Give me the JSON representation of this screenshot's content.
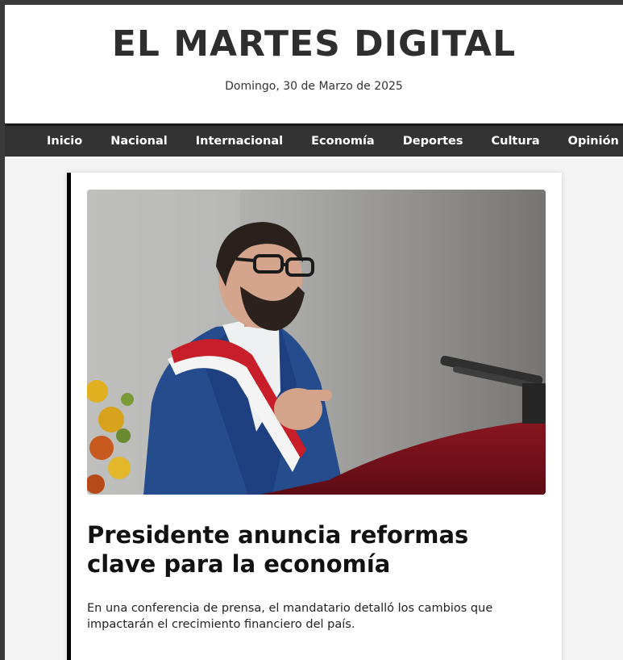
{
  "header": {
    "title": "EL MARTES DIGITAL",
    "date": "Domingo, 30 de Marzo de 2025"
  },
  "nav": {
    "items": [
      "Inicio",
      "Nacional",
      "Internacional",
      "Economía",
      "Deportes",
      "Cultura",
      "Opinión"
    ]
  },
  "article": {
    "image_icon": "photo-president-speaking",
    "title": "Presidente anuncia reformas clave para la economía",
    "summary": "En una conferencia de prensa, el mandatario detalló los cambios que impactarán el crecimiento financiero del país."
  },
  "colors": {
    "nav_bg": "#333333",
    "card_accent": "#000000",
    "page_bg": "#f3f3f3"
  }
}
